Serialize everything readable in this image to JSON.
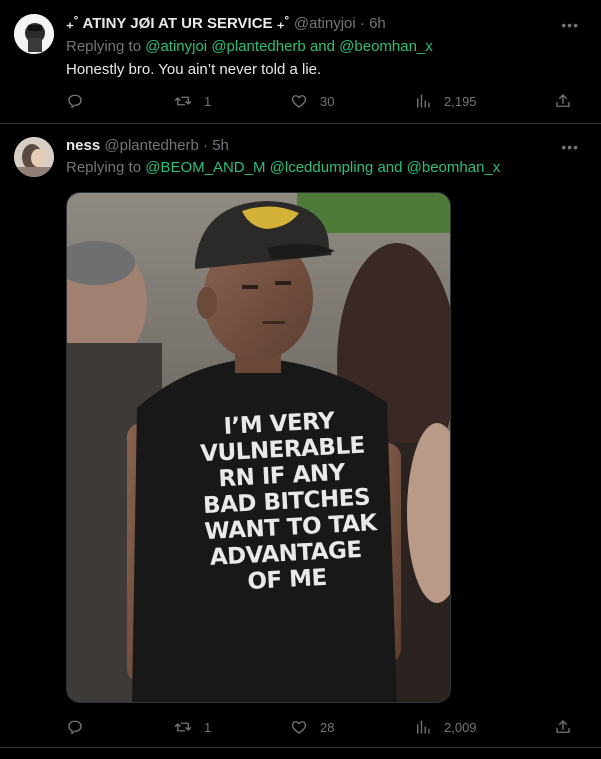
{
  "tweets": [
    {
      "display_name": "₊˚ ATINY JØI AT UR SERVICE ₊˚",
      "handle": "@atinyjoi",
      "time": "6h",
      "replying_prefix": "Replying to",
      "replying_mentions": [
        "@atinyjoi",
        "@plantedherb",
        "and",
        "@beomhan_x"
      ],
      "text": "Honestly bro. You ain’t never told a lie.",
      "actions": {
        "replies": "",
        "retweets": "1",
        "likes": "30",
        "views": "2,195"
      }
    },
    {
      "display_name": "ness",
      "handle": "@plantedherb",
      "time": "5h",
      "replying_prefix": "Replying to",
      "replying_mentions": [
        "@BEOM_AND_M",
        "@lceddumpling",
        "and",
        "@beomhan_x"
      ],
      "image": {
        "shirt_lines": [
          "I’M VERY",
          "VULNERABLE",
          "RN IF ANY",
          "BAD BITCHES",
          "WANT TO TAK",
          "ADVANTAGE",
          "OF ME"
        ]
      },
      "actions": {
        "replies": "",
        "retweets": "1",
        "likes": "28",
        "views": "2,009"
      }
    }
  ],
  "colors": {
    "background": "#000000",
    "text": "#e7e9ea",
    "muted": "#71767b",
    "mention": "#2cbf7a",
    "divider": "#2f3336"
  },
  "icons": [
    "reply-icon",
    "retweet-icon",
    "like-icon",
    "views-icon",
    "share-icon",
    "more-icon"
  ]
}
